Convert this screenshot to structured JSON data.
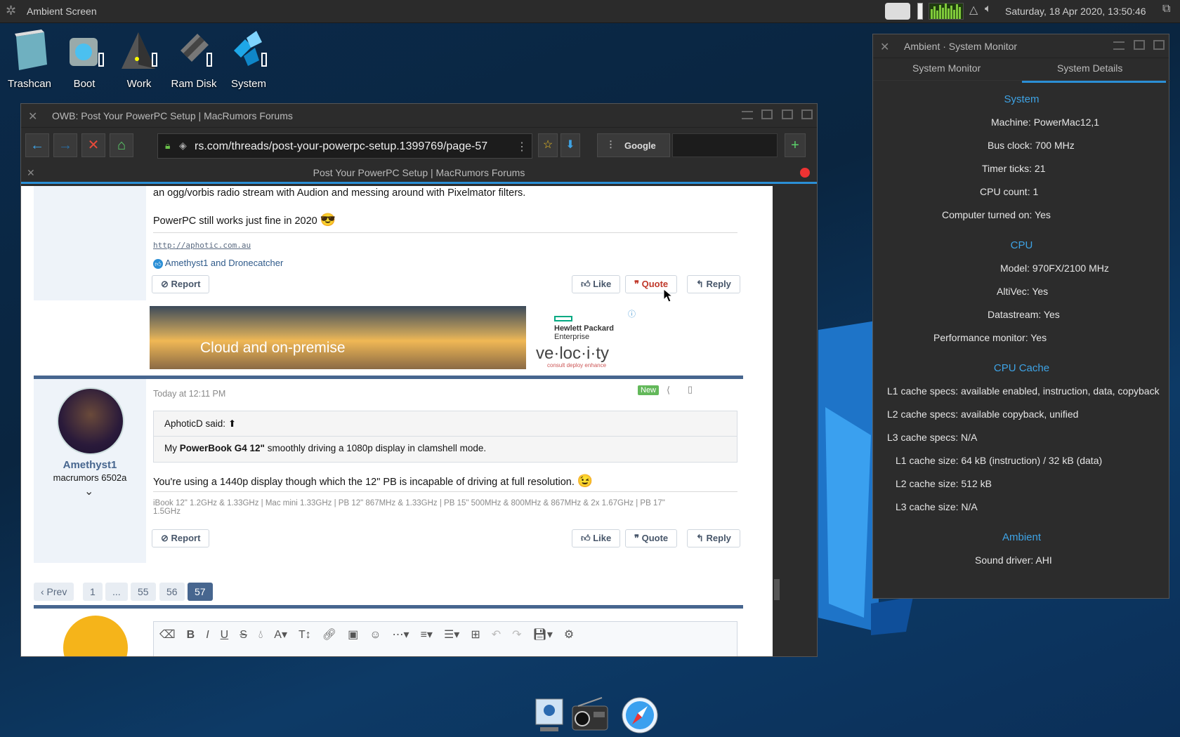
{
  "topbar": {
    "title": "Ambient Screen",
    "clock": "Saturday, 18 Apr 2020, 13:50:46",
    "icons": [
      "camera-icon",
      "battery-icon",
      "cpu-graph",
      "alert-icon",
      "volume-icon",
      "external-link-icon"
    ]
  },
  "desktop": {
    "icons": [
      {
        "label": "Trashcan"
      },
      {
        "label": "Boot"
      },
      {
        "label": "Work"
      },
      {
        "label": "Ram Disk"
      },
      {
        "label": "System"
      }
    ]
  },
  "browser": {
    "window_title": "OWB: Post Your PowerPC Setup | MacRumors Forums",
    "url": "rs.com/threads/post-your-powerpc-setup.1399769/page-57",
    "search_engine": "Google",
    "search_value": "",
    "tab_title": "Post Your PowerPC Setup | MacRumors Forums",
    "post1": {
      "line1": "an ogg/vorbis radio stream with Audion and messing around with Pixelmator filters.",
      "line2": "PowerPC still works just fine in 2020",
      "emoji": "😎",
      "signature": "http://aphotic.com.au",
      "reactions": "Amethyst1 and Dronecatcher",
      "report": "Report",
      "like": "Like",
      "quote": "Quote",
      "reply": "Reply"
    },
    "ad": {
      "headline": "Cloud and on-premise",
      "brand1": "Hewlett Packard",
      "brand2": "Enterprise",
      "tag": "ve·loc·i·ty",
      "sub": "consult  deploy  enhance"
    },
    "post2": {
      "date": "Today at 12:11 PM",
      "badge": "New",
      "username": "Amethyst1",
      "usertitle": "macrumors 6502a",
      "quote_author": "AphoticD said:",
      "quote_pre": "My ",
      "quote_bold": "PowerBook G4 12\"",
      "quote_post": " smoothly driving a 1080p display in clamshell mode.",
      "text": "You're using a 1440p display though which the 12\" PB is incapable of driving at full resolution.",
      "emoji": "😉",
      "signature_line1": "iBook 12\" 1.2GHz & 1.33GHz | Mac mini 1.33GHz | PB 12\" 867MHz & 1.33GHz | PB 15\" 500MHz & 800MHz & 867MHz & 2x 1.67GHz | PB 17\"",
      "signature_line2": "1.5GHz",
      "report": "Report",
      "like": "Like",
      "quote": "Quote",
      "reply": "Reply"
    },
    "pagination": {
      "prev": "‹ Prev",
      "pages": [
        "1",
        "...",
        "55",
        "56",
        "57"
      ],
      "current": "57"
    }
  },
  "sysmon": {
    "window_title": "Ambient · System Monitor",
    "tabs": [
      "System Monitor",
      "System Details"
    ],
    "active_tab": "System Details",
    "sections": {
      "system": "System",
      "cpu": "CPU",
      "cache": "CPU Cache",
      "ambient": "Ambient"
    },
    "rows": {
      "machine": "Machine: PowerMac12,1",
      "bus": "Bus clock: 700 MHz",
      "timer": "Timer ticks: 21",
      "cpucount": "CPU count: 1",
      "turnedon": "Computer turned on: Yes",
      "model": "Model: 970FX/2100 MHz",
      "altivec": "AltiVec: Yes",
      "datastream": "Datastream: Yes",
      "perfmon": "Performance monitor: Yes",
      "l1spec": "L1 cache specs: available enabled, instruction, data, copyback",
      "l2spec": "L2 cache specs: available copyback, unified",
      "l3spec": "L3 cache specs: N/A",
      "l1size": "L1 cache size: 64 kB (instruction) / 32 kB (data)",
      "l2size": "L2 cache size: 512 kB",
      "l3size": "L3 cache size: N/A",
      "sound": "Sound driver: AHI"
    }
  },
  "colors": {
    "accent": "#2b8fd6",
    "forum_blue": "#47668f",
    "quote_red": "#c0392b"
  }
}
